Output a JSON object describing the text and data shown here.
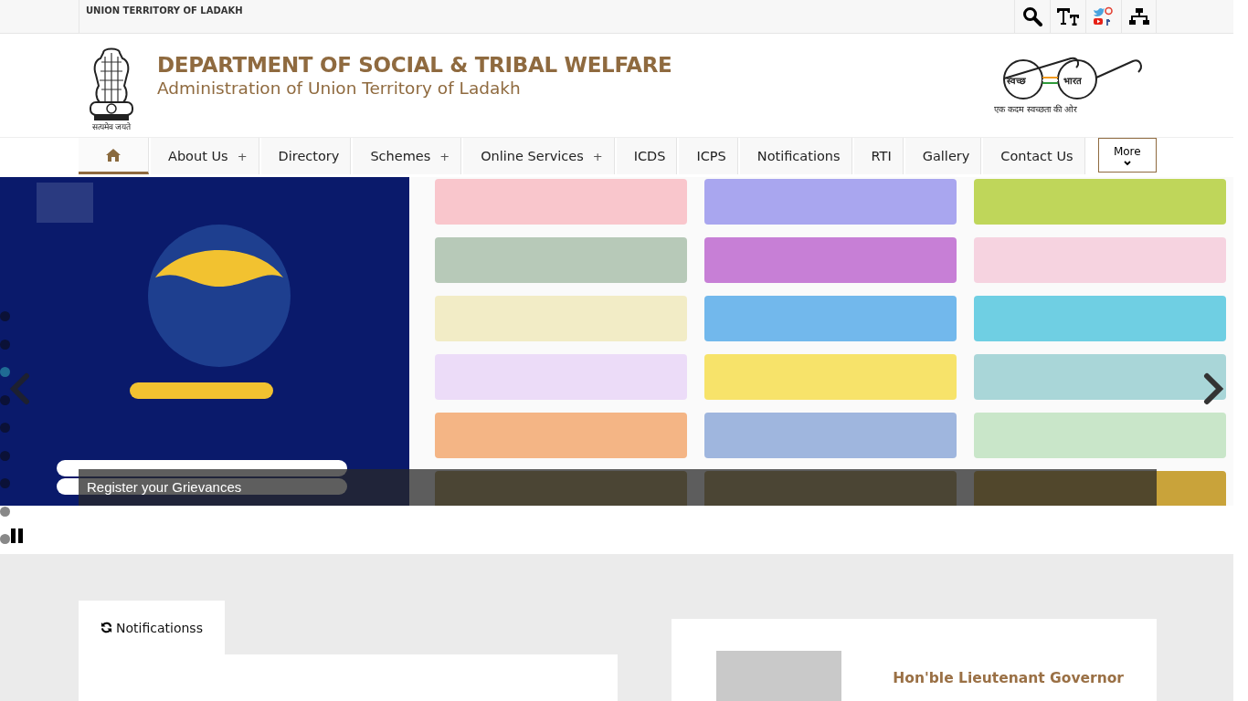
{
  "top_bar": {
    "title": "UNION TERRITORY OF LADAKH"
  },
  "header": {
    "emblem_motto": "सत्यमेव जयते",
    "title": "DEPARTMENT OF SOCIAL & TRIBAL WELFARE",
    "subtitle": "Administration of Union Territory of Ladakh",
    "swachh_left": "स्वच्छ",
    "swachh_right": "भारत",
    "swachh_tagline": "एक कदम स्वच्छता की ओर"
  },
  "nav": [
    {
      "kind": "home",
      "selected": true
    },
    {
      "kind": "link",
      "label": "About Us",
      "marker": "+",
      "selected": false
    },
    {
      "kind": "link",
      "label": "Directory",
      "selected": false
    },
    {
      "kind": "link",
      "label": "Schemes",
      "marker": "+",
      "selected": false
    },
    {
      "kind": "link",
      "label": "Online Services",
      "marker": "+",
      "selected": false
    },
    {
      "kind": "link",
      "label": "ICDS",
      "selected": false
    },
    {
      "kind": "link",
      "label": "ICPS",
      "selected": false
    },
    {
      "kind": "link",
      "label": "Notifications",
      "selected": false
    },
    {
      "kind": "link",
      "label": "RTI",
      "selected": false
    },
    {
      "kind": "link",
      "label": "Gallery",
      "selected": false
    },
    {
      "kind": "link",
      "label": "Contact Us",
      "selected": false
    },
    {
      "kind": "more",
      "label": "More",
      "selected": false
    }
  ],
  "slider": {
    "caption": "Register your Grievances",
    "dots": [
      {
        "selected": false
      },
      {
        "selected": false
      },
      {
        "selected": true
      },
      {
        "selected": false
      },
      {
        "selected": false
      },
      {
        "selected": false
      },
      {
        "selected": false
      },
      {
        "selected": false
      },
      {
        "selected": false
      }
    ]
  },
  "notifications_tab": {
    "label": "Notificationss"
  },
  "governor_card": {
    "title": "Hon'ble Lieutenant Governor"
  }
}
